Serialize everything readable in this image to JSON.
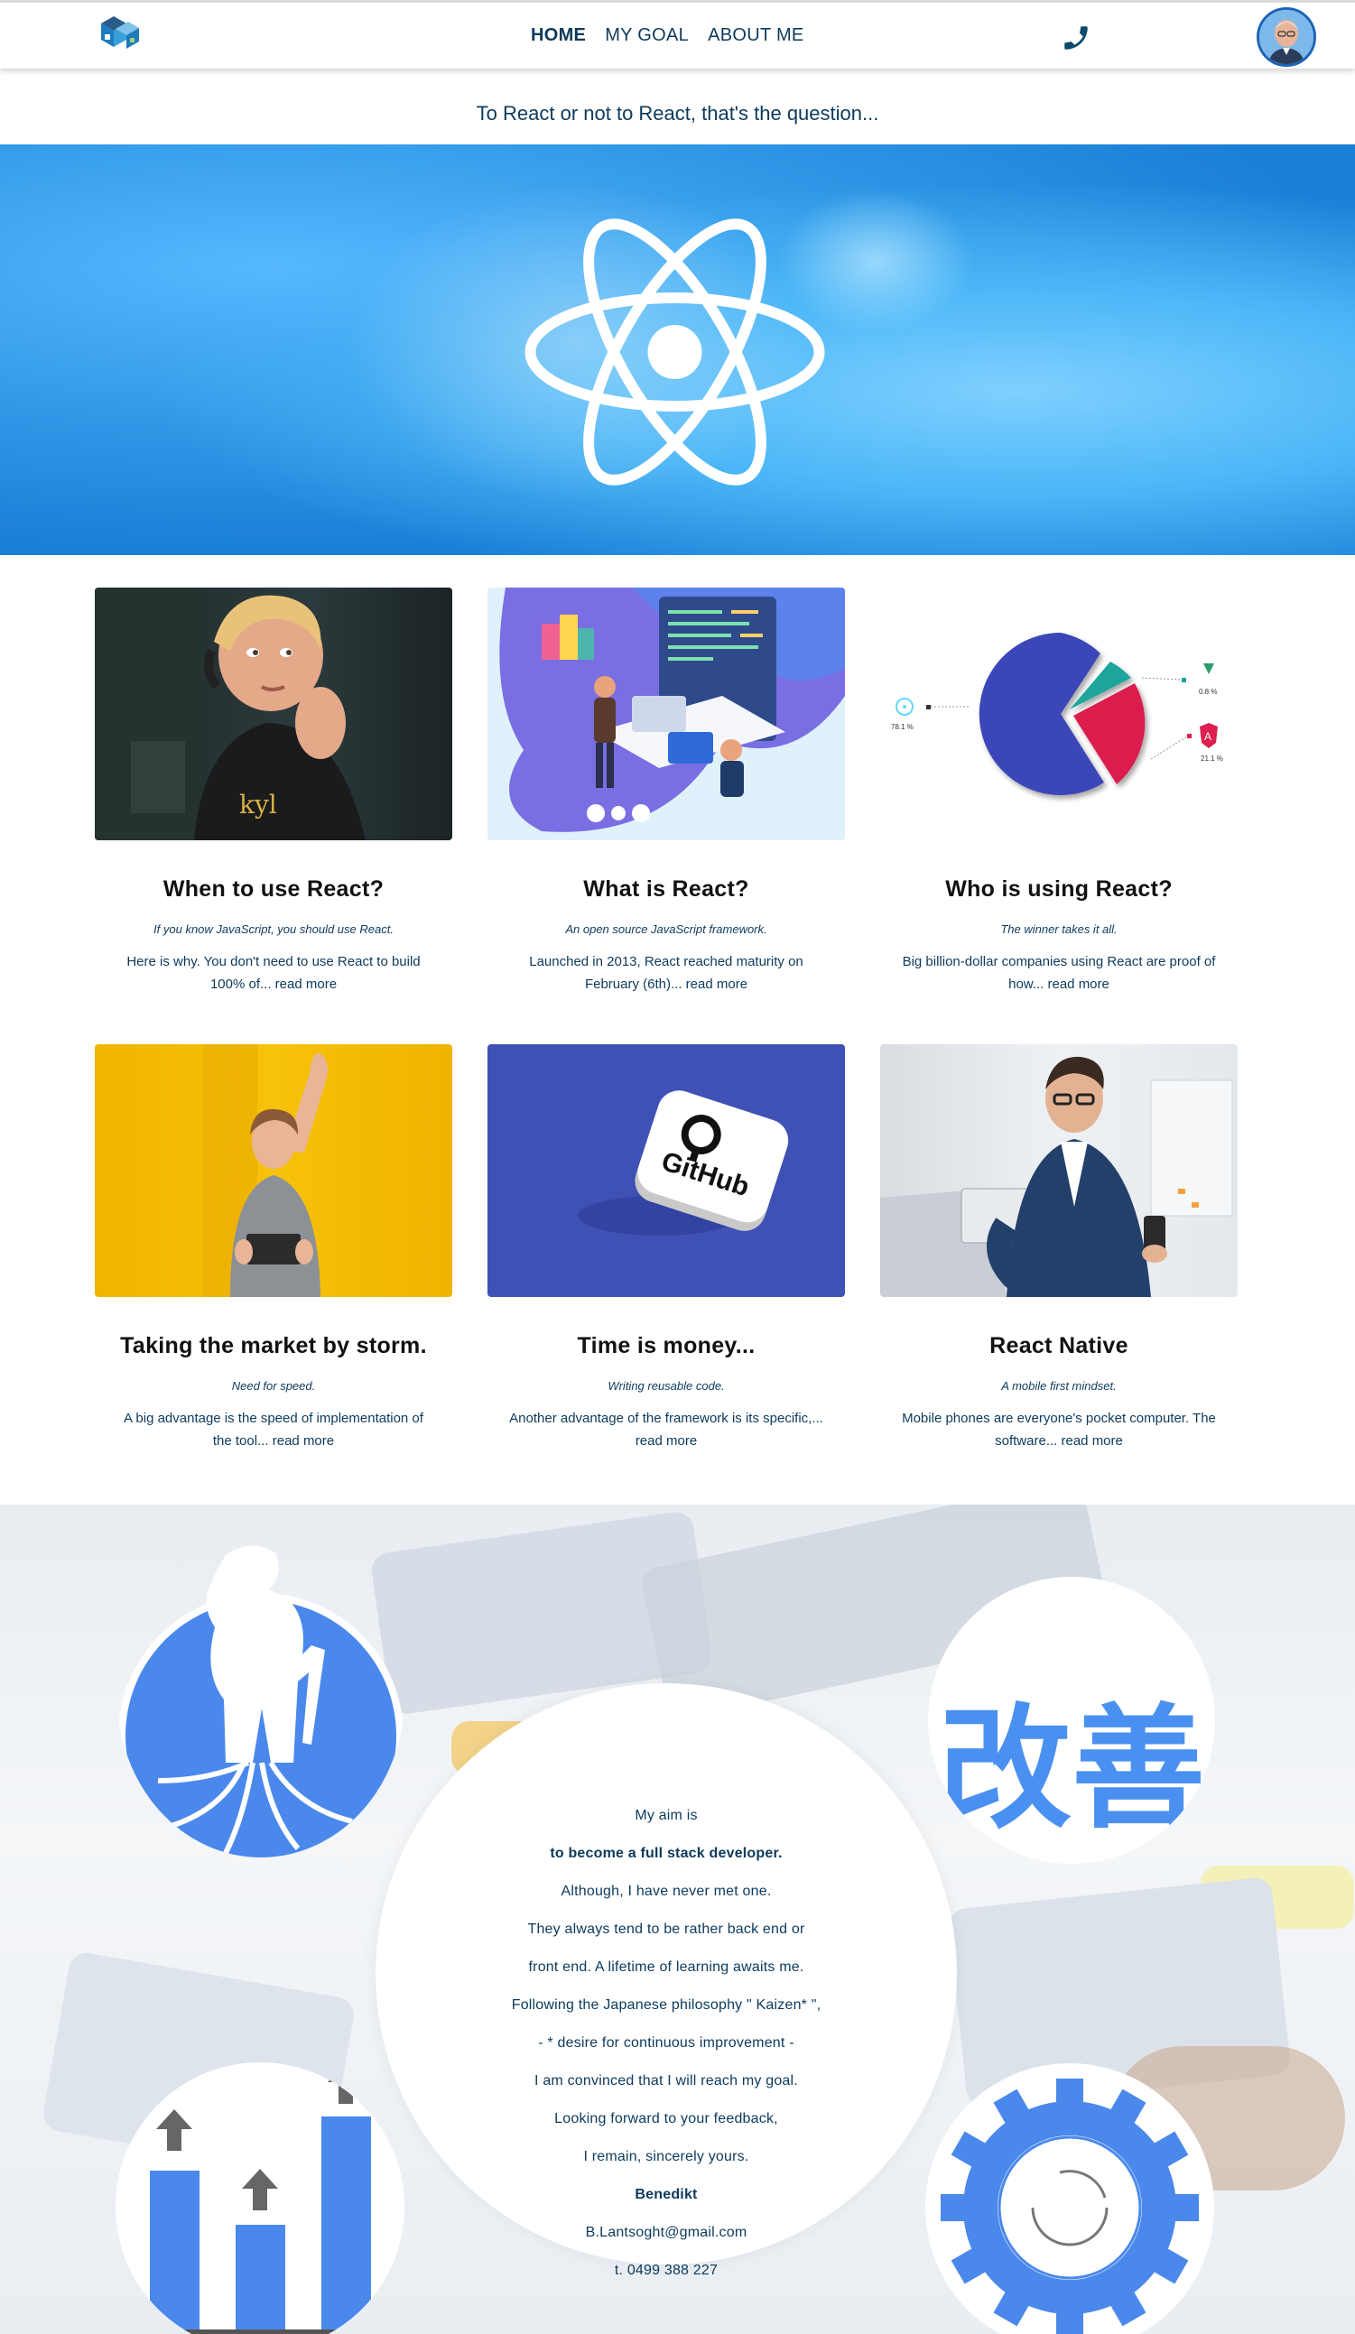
{
  "nav": {
    "links": [
      {
        "label": "HOME",
        "active": true
      },
      {
        "label": "MY GOAL",
        "active": false
      },
      {
        "label": "ABOUT ME",
        "active": false
      }
    ]
  },
  "tagline": "To React or not to React, that's the question...",
  "cards": [
    {
      "title": "When to use React?",
      "subtitle": "If you know JavaScript, you should use React.",
      "text": "Here is why. You don't need to use React to build 100% of...",
      "more": "read more"
    },
    {
      "title": "What is React?",
      "subtitle": "An open source JavaScript framework.",
      "text": "Launched in 2013, React reached maturity on February (6th)...",
      "more": "read more"
    },
    {
      "title": "Who is using React?",
      "subtitle": "The winner takes it all.",
      "text": "Big billion-dollar companies using React are proof of how...",
      "more": "read more"
    },
    {
      "title": "Taking the market by storm.",
      "subtitle": "Need for speed.",
      "text": "A big advantage is the speed of implementation of the tool...",
      "more": "read more"
    },
    {
      "title": "Time is money...",
      "subtitle": "Writing reusable code.",
      "text": "Another advantage of the framework is its specific,...",
      "more": "read more"
    },
    {
      "title": "React Native",
      "subtitle": "A mobile first mindset.",
      "text": "Mobile phones are everyone's pocket computer. The software...",
      "more": "read more"
    }
  ],
  "pie": {
    "react_pct": "78.1 %",
    "vue_pct": "0.8 %",
    "angular_pct": "21.1 %"
  },
  "github_label": "GitHub",
  "goal": {
    "lines": [
      {
        "text": "My aim is",
        "bold": false
      },
      {
        "text": "to become a full stack developer.",
        "bold": true
      },
      {
        "text": "Although, I have never met one.",
        "bold": false
      },
      {
        "text": "They always tend to be rather back end or",
        "bold": false
      },
      {
        "text": "front end. A lifetime of learning awaits me.",
        "bold": false
      },
      {
        "text": "Following the Japanese philosophy \" Kaizen* \",",
        "bold": false
      },
      {
        "text": "- * desire for continuous improvement -",
        "bold": false
      },
      {
        "text": "I am convinced that I will reach my goal.",
        "bold": false
      },
      {
        "text": "Looking forward to your feedback,",
        "bold": false
      },
      {
        "text": "I remain, sincerely yours.",
        "bold": false
      },
      {
        "text": "Benedikt",
        "bold": true
      },
      {
        "text": "B.Lantsoght@gmail.com",
        "bold": false
      },
      {
        "text": "t. 0499 388 227",
        "bold": false
      }
    ],
    "kaizen": "改善"
  },
  "colors": {
    "brand_dark": "#0d3a5c",
    "accent_blue": "#4a90f0",
    "hero_blue": "#2a93e8"
  }
}
